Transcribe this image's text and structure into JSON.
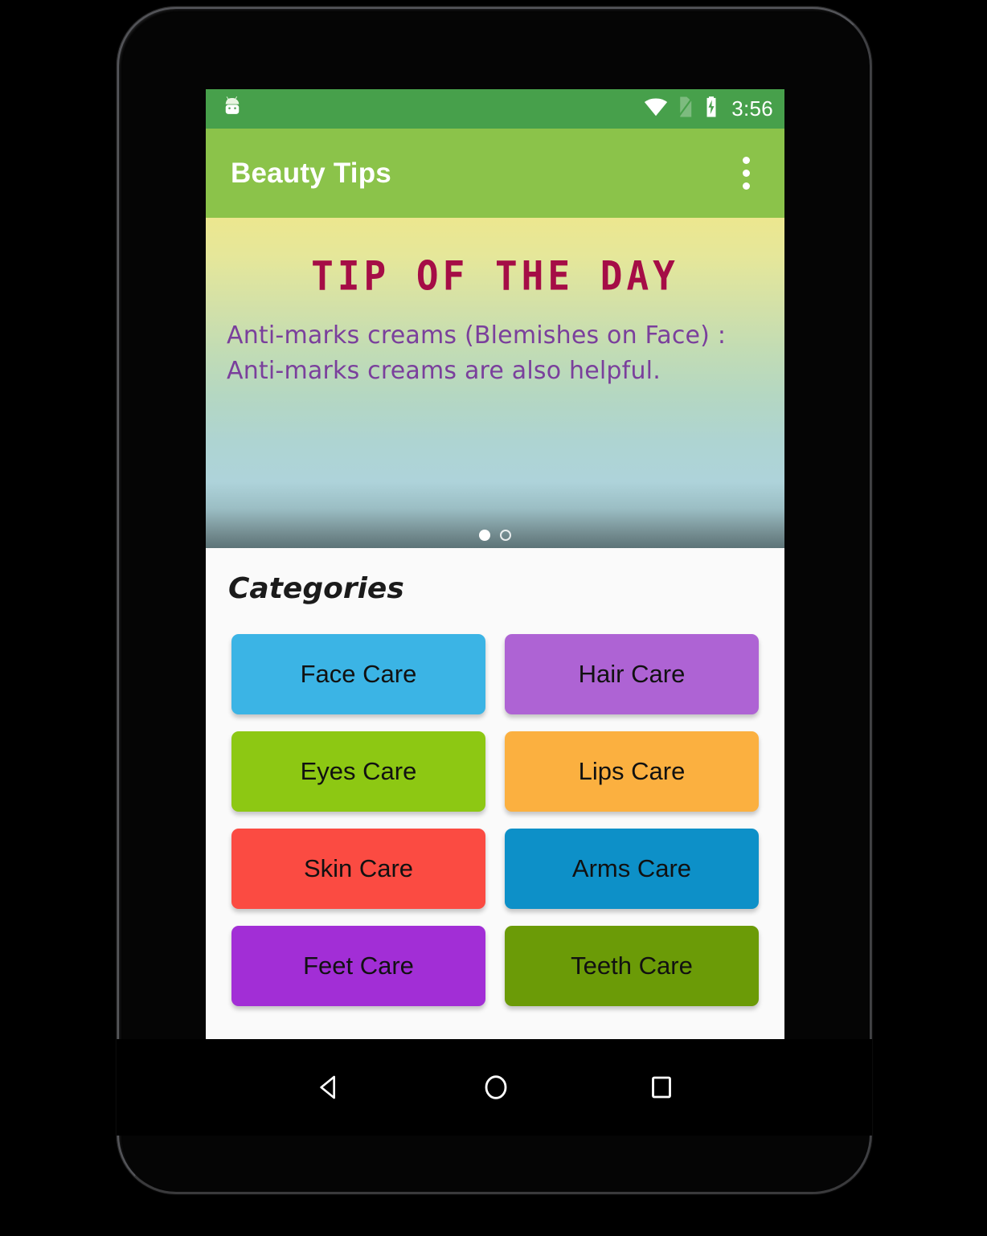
{
  "status_bar": {
    "icons": [
      "android-robot-icon",
      "wifi-icon",
      "sim-card-off-icon",
      "battery-charging-icon"
    ],
    "time": "3:56",
    "background_color": "#47a04b"
  },
  "app_bar": {
    "title": "Beauty Tips",
    "overflow_label": "more-options",
    "background_color": "#8bc34a"
  },
  "tip_card": {
    "heading": "TIP OF THE DAY",
    "heading_color": "#a50d46",
    "body": "Anti-marks creams (Blemishes on Face) : Anti-marks creams are also helpful.",
    "body_color": "#7a3f9c",
    "page_dots": {
      "total": 2,
      "active_index": 0
    }
  },
  "categories": {
    "title": "Categories",
    "items": [
      {
        "label": "Face Care",
        "color": "#3bb4e5"
      },
      {
        "label": "Hair Care",
        "color": "#ae63d4"
      },
      {
        "label": "Eyes Care",
        "color": "#8dc813"
      },
      {
        "label": "Lips Care",
        "color": "#fbb040"
      },
      {
        "label": "Skin Care",
        "color": "#fb4b42"
      },
      {
        "label": "Arms Care",
        "color": "#0d90c8"
      },
      {
        "label": "Feet Care",
        "color": "#a22ed6"
      },
      {
        "label": "Teeth Care",
        "color": "#6b9b07"
      }
    ]
  },
  "nav_bar": {
    "buttons": [
      {
        "name": "back-icon",
        "label": "Back"
      },
      {
        "name": "home-icon",
        "label": "Home"
      },
      {
        "name": "recents-icon",
        "label": "Recent apps"
      }
    ]
  }
}
